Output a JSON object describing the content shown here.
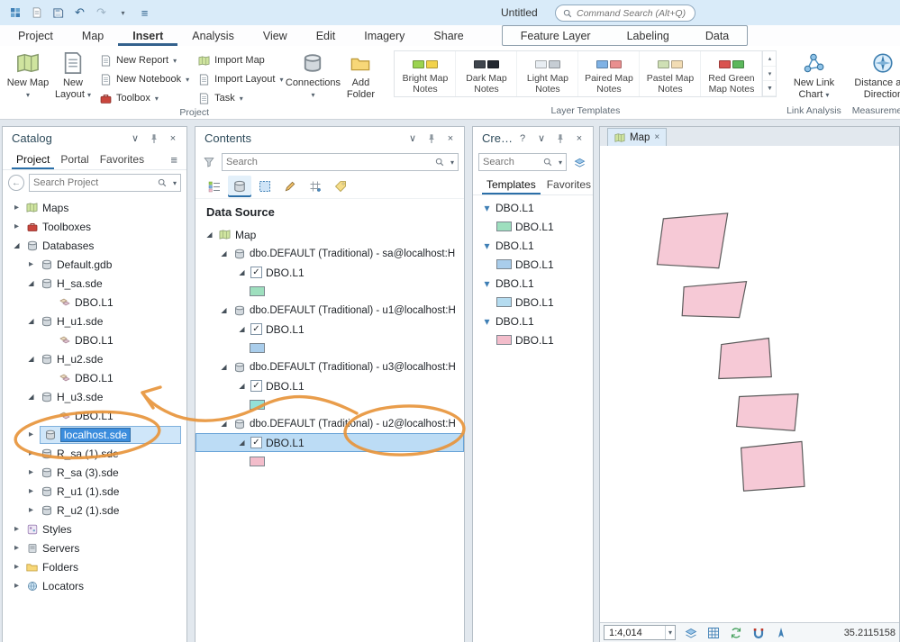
{
  "titlebar": {
    "title": "Untitled",
    "command_search_placeholder": "Command Search (Alt+Q)"
  },
  "icons": {
    "collapsed": "▸",
    "expanded": "◢",
    "dropdown": "▾",
    "close": "×",
    "menu": "≡",
    "back": "←",
    "undo": "↶",
    "redo": "↷",
    "help": "?",
    "check": "✓",
    "chevron_down": "∨",
    "scroll_up": "▴",
    "scroll_down": "▾",
    "gallery_expand": "▼"
  },
  "ribbon": {
    "tabs": [
      "Project",
      "Map",
      "Insert",
      "Analysis",
      "View",
      "Edit",
      "Imagery",
      "Share"
    ],
    "active_tab": "Insert",
    "contextual_tabs": [
      "Feature Layer",
      "Labeling",
      "Data"
    ],
    "project": {
      "label": "Project",
      "new_map": "New Map",
      "new_layout": "New Layout",
      "new_report": "New Report",
      "new_notebook": "New Notebook",
      "toolbox": "Toolbox",
      "import_map": "Import Map",
      "import_layout": "Import Layout",
      "task": "Task",
      "connections": "Connections",
      "add_folder": "Add Folder"
    },
    "layer_templates": {
      "label": "Layer Templates",
      "items": [
        "Bright Map Notes",
        "Dark Map Notes",
        "Light Map Notes",
        "Paired Map Notes",
        "Pastel Map Notes",
        "Red Green Map Notes"
      ]
    },
    "link_analysis": {
      "label": "Link Analysis",
      "new_link_chart": "New Link Chart"
    },
    "measurements": {
      "label": "Measurements",
      "distance_and_direction": "Distance and Direction"
    }
  },
  "catalog": {
    "title": "Catalog",
    "tabs": [
      "Project",
      "Portal",
      "Favorites"
    ],
    "active_tab": "Project",
    "search_placeholder": "Search Project",
    "items": [
      "Maps",
      "Toolboxes",
      "Databases",
      "Default.gdb",
      "H_sa.sde",
      "DBO.L1",
      "H_u1.sde",
      "DBO.L1",
      "H_u2.sde",
      "DBO.L1",
      "H_u3.sde",
      "DBO.L1",
      "localhost.sde",
      "R_sa (1).sde",
      "R_sa (3).sde",
      "R_u1 (1).sde",
      "R_u2 (1).sde",
      "Styles",
      "Servers",
      "Folders",
      "Locators"
    ]
  },
  "contents": {
    "title": "Contents",
    "search_placeholder": "Search",
    "section_heading": "Data Source",
    "map_label": "Map",
    "groups": [
      {
        "source": "dbo.DEFAULT (Traditional) - sa@localhost:H",
        "layer": "DBO.L1",
        "swatch": "#9edfbe"
      },
      {
        "source": "dbo.DEFAULT (Traditional) - u1@localhost:H",
        "layer": "DBO.L1",
        "swatch": "#a9cdeb"
      },
      {
        "source": "dbo.DEFAULT (Traditional) - u3@localhost:H",
        "layer": "DBO.L1",
        "swatch": "#93e1d8"
      },
      {
        "source": "dbo.DEFAULT (Traditional) - u2@localhost:H",
        "layer": "DBO.L1",
        "swatch": "#f3bdcb"
      }
    ]
  },
  "create_features": {
    "title": "Create F...",
    "search_placeholder": "Search",
    "tabs": [
      "Templates",
      "Favorites"
    ],
    "active_tab": "Templates",
    "groups": [
      {
        "name": "DBO.L1",
        "template": "DBO.L1",
        "swatch": "#9edfbe"
      },
      {
        "name": "DBO.L1",
        "template": "DBO.L1",
        "swatch": "#a9cdeb"
      },
      {
        "name": "DBO.L1",
        "template": "DBO.L1",
        "swatch": "#b5dcf0"
      },
      {
        "name": "DBO.L1",
        "template": "DBO.L1",
        "swatch": "#f3bdcb"
      }
    ]
  },
  "map": {
    "tab_label": "Map",
    "scale": "1:4,014",
    "coordinate": "35.2115158",
    "feature_fill": "#f6c9d6",
    "feature_stroke": "#5a5a5a",
    "polygons": [
      "71,81 143,75 133,136 64,132",
      "94,157 164,151 156,191 92,189",
      "136,221 189,214 192,257 133,259",
      "156,279 222,276 218,317 153,312",
      "158,336 226,329 229,379 161,384"
    ]
  },
  "annotation": {
    "color": "#e8953c"
  }
}
